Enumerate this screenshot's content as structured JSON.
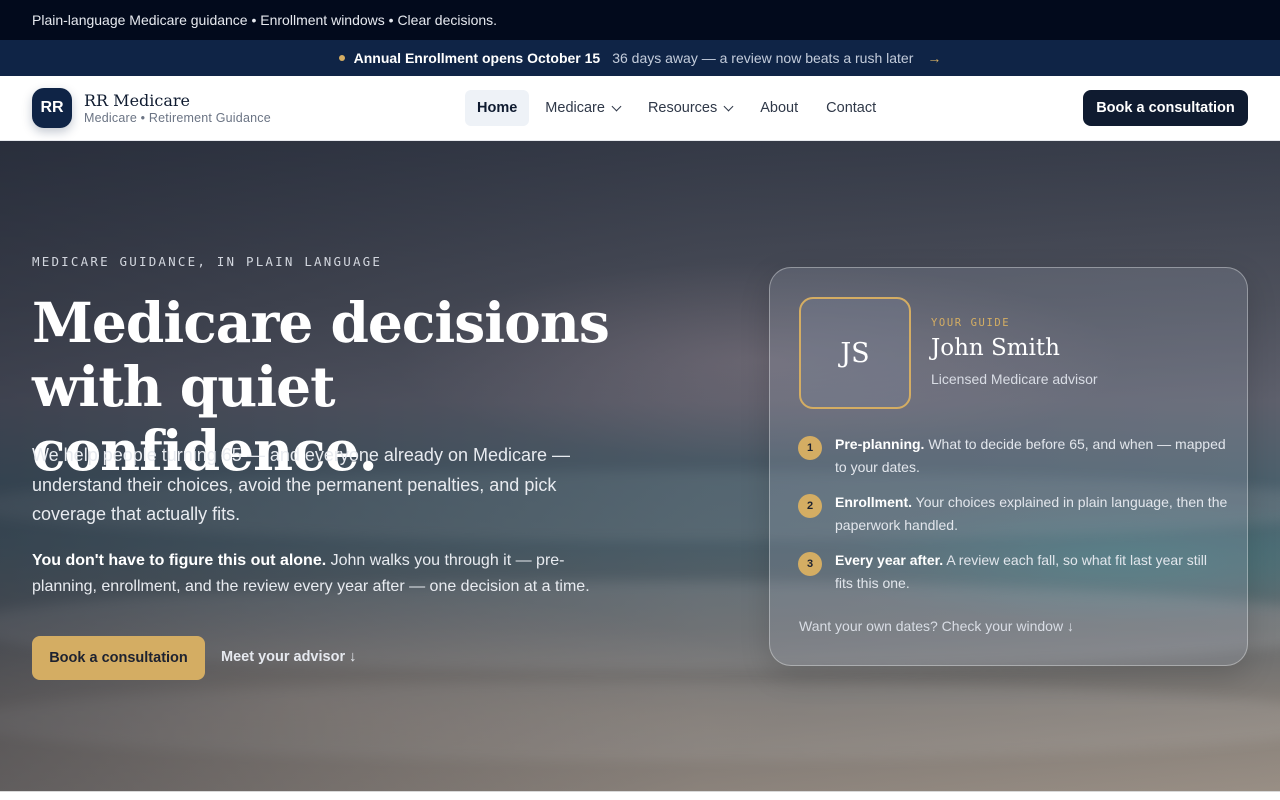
{
  "utility_bar": {
    "text": "Plain-language Medicare guidance • Enrollment windows • Clear decisions."
  },
  "announcement": {
    "headline": "Annual Enrollment opens October 15",
    "detail": "36 days away — a review now beats a rush later",
    "arrow": "→"
  },
  "brand": {
    "initials": "RR",
    "name": "RR Medicare",
    "tagline": "Medicare • Retirement Guidance"
  },
  "nav": {
    "items": [
      {
        "label": "Home",
        "active": true,
        "has_dropdown": false
      },
      {
        "label": "Medicare",
        "active": false,
        "has_dropdown": true
      },
      {
        "label": "Resources",
        "active": false,
        "has_dropdown": true
      },
      {
        "label": "About",
        "active": false,
        "has_dropdown": false
      },
      {
        "label": "Contact",
        "active": false,
        "has_dropdown": false
      }
    ],
    "cta": "Book a consultation"
  },
  "hero": {
    "eyebrow": "MEDICARE GUIDANCE, IN PLAIN LANGUAGE",
    "headline_line1": "Medicare decisions",
    "headline_line2": "with quiet confidence.",
    "lede": "We help people turning 65 — and everyone already on Medicare — understand their choices, avoid the permanent penalties, and pick coverage that actually fits.",
    "support_strong": "You don't have to figure this out alone.",
    "support_rest": " John walks you through it — pre-planning, enrollment, and the review every year after — one decision at a time.",
    "primary_cta": "Book a consultation",
    "secondary_cta": "Meet your advisor ↓"
  },
  "advisor_card": {
    "initials": "JS",
    "label": "YOUR GUIDE",
    "name": "John Smith",
    "role": "Licensed Medicare advisor",
    "steps": [
      {
        "num": "1",
        "title": "Pre-planning.",
        "text": " What to decide before 65, and when — mapped to your dates."
      },
      {
        "num": "2",
        "title": "Enrollment.",
        "text": " Your choices explained in plain language, then the paperwork handled."
      },
      {
        "num": "3",
        "title": "Every year after.",
        "text": " A review each fall, so what fit last year still fits this one."
      }
    ],
    "link": "Want your own dates? Check your window ↓"
  },
  "colors": {
    "navy": "#0f1b30",
    "gold": "#d4ad63",
    "announce_bg": "#0f2446",
    "utility_bg": "#020a1c"
  }
}
